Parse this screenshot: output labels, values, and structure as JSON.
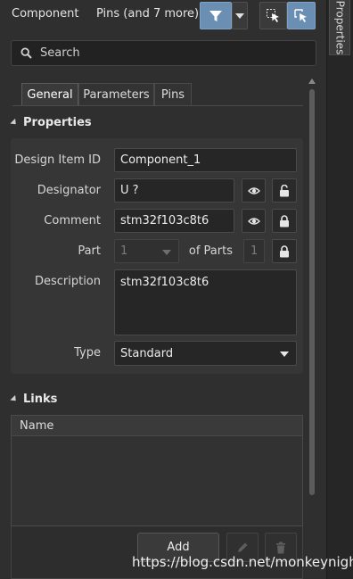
{
  "header": {
    "title": "Component",
    "filter_text": "Pins (and 7 more)"
  },
  "search": {
    "placeholder": "Search"
  },
  "tabs": [
    {
      "label": "General",
      "active": true
    },
    {
      "label": "Parameters",
      "active": false
    },
    {
      "label": "Pins",
      "active": false
    }
  ],
  "properties": {
    "section_title": "Properties",
    "design_item_id": {
      "label": "Design Item ID",
      "value": "Component_1"
    },
    "designator": {
      "label": "Designator",
      "value": "U ?"
    },
    "comment": {
      "label": "Comment",
      "value": "stm32f103c8t6"
    },
    "part": {
      "label": "Part",
      "value": "1",
      "of_parts_label": "of Parts",
      "total": "1"
    },
    "description": {
      "label": "Description",
      "value": "stm32f103c8t6"
    },
    "type": {
      "label": "Type",
      "value": "Standard"
    }
  },
  "links": {
    "section_title": "Links",
    "column_name": "Name",
    "add_label": "Add"
  },
  "side_tab": {
    "label": "Properties"
  },
  "watermark": "https://blog.csdn.net/monkeynight",
  "colors": {
    "accent": "#6b8fb3",
    "panel_bg": "#2f2f2f",
    "field_bg": "#262626"
  }
}
